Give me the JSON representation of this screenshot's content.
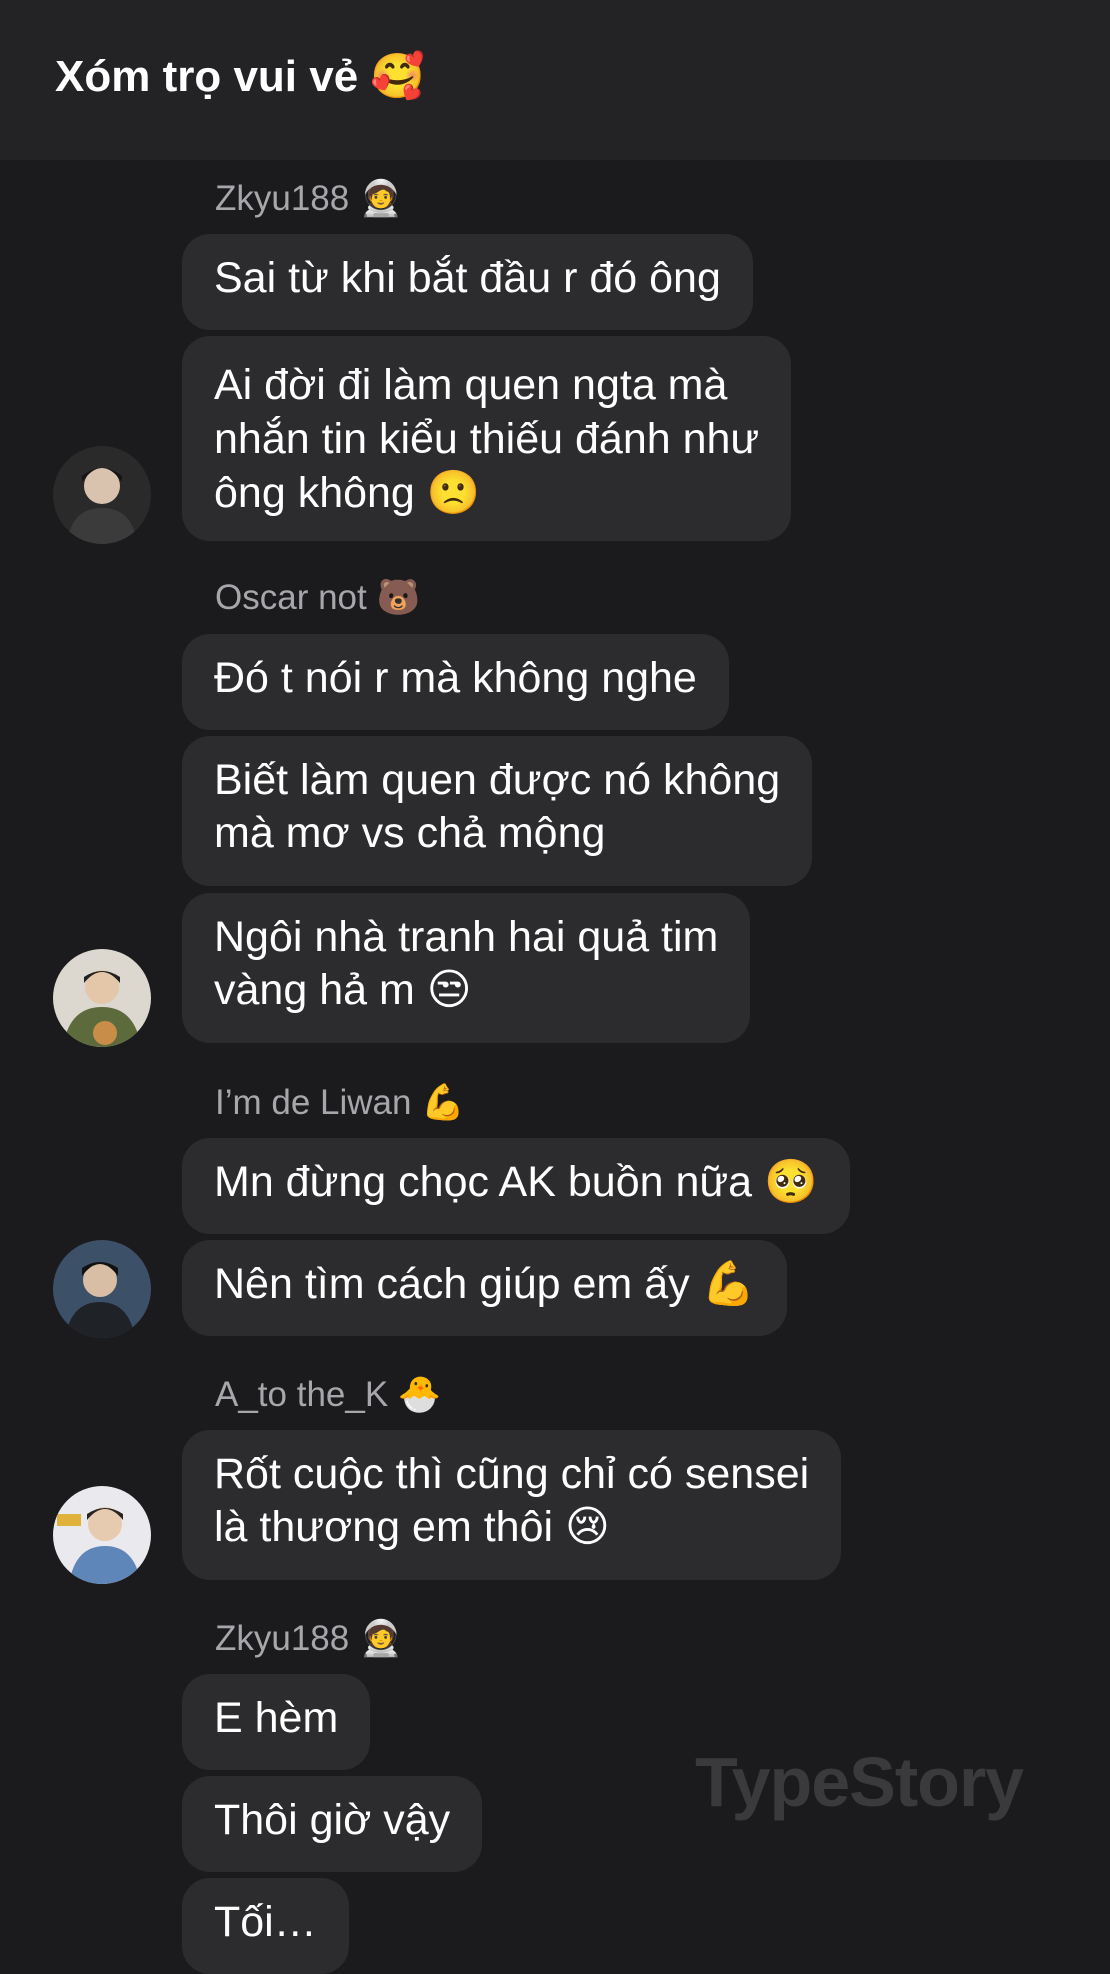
{
  "header": {
    "title": "Xóm trọ vui vẻ 🥰"
  },
  "groups": [
    {
      "sender": "Zkyu188 🧑‍🚀",
      "messages": [
        {
          "line1": "Sai từ khi bắt đầu r đó ông"
        },
        {
          "line1": "Ai đời đi làm quen ngta mà",
          "line2": "nhắn tin kiểu thiếu đánh như",
          "line3": "ông không 🙁"
        }
      ]
    },
    {
      "sender": "Oscar not 🐻",
      "messages": [
        {
          "line1": "Đó t nói r mà không nghe"
        },
        {
          "line1": "Biết làm quen được nó không",
          "line2": "mà mơ vs chả mộng"
        },
        {
          "line1": "Ngôi nhà tranh hai quả tim",
          "line2": "vàng hả m 😒"
        }
      ]
    },
    {
      "sender": "I’m de Liwan 💪",
      "messages": [
        {
          "line1": "Mn đừng chọc AK buồn nữa 🥺"
        },
        {
          "line1": "Nên tìm cách giúp em ấy 💪"
        }
      ]
    },
    {
      "sender": "A_to the_K 🐣",
      "messages": [
        {
          "line1": "Rốt cuộc thì cũng chỉ có sensei",
          "line2": "là thương em thôi 😢"
        }
      ]
    },
    {
      "sender": "Zkyu188 🧑‍🚀",
      "messages": [
        {
          "line1": "E hèm"
        },
        {
          "line1": "Thôi giờ vậy"
        },
        {
          "line1": "Tối…"
        }
      ]
    }
  ],
  "watermark": "TypeStory",
  "colors": {
    "background": "#1b1b1d",
    "header": "#232325",
    "bubble": "#2c2c2e",
    "sender_text": "#a7a7ab",
    "message_text": "#ffffff"
  }
}
